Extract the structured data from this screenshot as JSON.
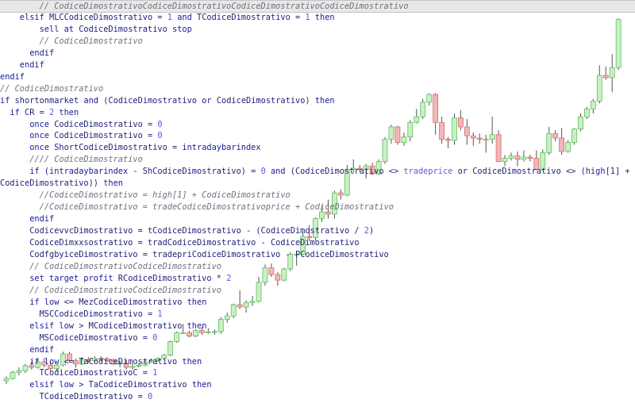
{
  "colors": {
    "bull_fill": "#c9f0c5",
    "bull_stroke": "#5fbf5f",
    "bear_fill": "#f2b6b6",
    "bear_stroke": "#d06f6f",
    "keyword": "#1a1a9a",
    "comment": "#707080",
    "number": "#5a5ae0",
    "text": "#22227a",
    "current_line_bg": "#e8e8e8"
  },
  "chart_data": {
    "type": "candlestick",
    "candles": [
      {
        "o": 0.0,
        "h": 2.0,
        "l": -1.5,
        "c": 1.0
      },
      {
        "o": 1.0,
        "h": 4.5,
        "l": 0.5,
        "c": 3.8
      },
      {
        "o": 3.8,
        "h": 6.0,
        "l": 2.5,
        "c": 4.5
      },
      {
        "o": 4.5,
        "h": 7.5,
        "l": 3.5,
        "c": 6.8
      },
      {
        "o": 6.8,
        "h": 8.5,
        "l": 5.0,
        "c": 6.0
      },
      {
        "o": 6.0,
        "h": 9.5,
        "l": 5.5,
        "c": 8.5
      },
      {
        "o": 8.5,
        "h": 10.0,
        "l": 6.0,
        "c": 7.0
      },
      {
        "o": 7.0,
        "h": 8.5,
        "l": 4.5,
        "c": 5.5
      },
      {
        "o": 5.5,
        "h": 7.5,
        "l": 4.5,
        "c": 7.0
      },
      {
        "o": 7.0,
        "h": 13.0,
        "l": 6.5,
        "c": 12.0
      },
      {
        "o": 12.0,
        "h": 13.0,
        "l": 8.5,
        "c": 9.0
      },
      {
        "o": 9.0,
        "h": 10.0,
        "l": 6.0,
        "c": 7.5
      },
      {
        "o": 7.5,
        "h": 10.5,
        "l": 7.0,
        "c": 9.5
      },
      {
        "o": 9.5,
        "h": 10.5,
        "l": 8.0,
        "c": 9.0
      },
      {
        "o": 9.0,
        "h": 11.0,
        "l": 8.0,
        "c": 10.0
      },
      {
        "o": 10.0,
        "h": 11.0,
        "l": 8.5,
        "c": 9.8
      },
      {
        "o": 9.8,
        "h": 10.5,
        "l": 8.5,
        "c": 9.0
      },
      {
        "o": 9.0,
        "h": 10.0,
        "l": 7.0,
        "c": 7.5
      },
      {
        "o": 7.5,
        "h": 9.0,
        "l": 6.0,
        "c": 8.0
      },
      {
        "o": 8.0,
        "h": 9.5,
        "l": 5.0,
        "c": 6.0
      },
      {
        "o": 6.0,
        "h": 7.5,
        "l": 5.0,
        "c": 6.5
      },
      {
        "o": 6.5,
        "h": 8.0,
        "l": 6.0,
        "c": 7.0
      },
      {
        "o": 7.0,
        "h": 9.5,
        "l": 6.5,
        "c": 8.5
      },
      {
        "o": 8.5,
        "h": 10.0,
        "l": 8.0,
        "c": 9.0
      },
      {
        "o": 9.0,
        "h": 10.5,
        "l": 8.5,
        "c": 10.0
      },
      {
        "o": 10.0,
        "h": 12.0,
        "l": 9.5,
        "c": 11.5
      },
      {
        "o": 11.5,
        "h": 18.0,
        "l": 11.0,
        "c": 17.5
      },
      {
        "o": 17.5,
        "h": 22.0,
        "l": 17.0,
        "c": 21.5
      },
      {
        "o": 21.5,
        "h": 25.5,
        "l": 21.0,
        "c": 21.5
      },
      {
        "o": 21.5,
        "h": 22.5,
        "l": 19.5,
        "c": 20.0
      },
      {
        "o": 20.0,
        "h": 23.0,
        "l": 19.5,
        "c": 22.5
      },
      {
        "o": 22.5,
        "h": 24.0,
        "l": 20.5,
        "c": 21.5
      },
      {
        "o": 21.5,
        "h": 23.5,
        "l": 21.0,
        "c": 22.0
      },
      {
        "o": 22.0,
        "h": 23.0,
        "l": 20.5,
        "c": 22.0
      },
      {
        "o": 22.0,
        "h": 28.5,
        "l": 21.0,
        "c": 27.5
      },
      {
        "o": 27.5,
        "h": 30.5,
        "l": 26.0,
        "c": 29.0
      },
      {
        "o": 29.0,
        "h": 34.5,
        "l": 28.0,
        "c": 34.0
      },
      {
        "o": 34.0,
        "h": 40.5,
        "l": 32.0,
        "c": 33.0
      },
      {
        "o": 33.0,
        "h": 36.0,
        "l": 30.5,
        "c": 35.0
      },
      {
        "o": 35.0,
        "h": 38.0,
        "l": 33.5,
        "c": 35.5
      },
      {
        "o": 35.5,
        "h": 46.5,
        "l": 35.0,
        "c": 44.0
      },
      {
        "o": 44.0,
        "h": 52.0,
        "l": 42.5,
        "c": 50.5
      },
      {
        "o": 50.5,
        "h": 52.5,
        "l": 46.5,
        "c": 47.5
      },
      {
        "o": 47.5,
        "h": 48.5,
        "l": 42.5,
        "c": 45.0
      },
      {
        "o": 45.0,
        "h": 50.5,
        "l": 44.5,
        "c": 50.0
      },
      {
        "o": 50.0,
        "h": 57.5,
        "l": 49.0,
        "c": 56.5
      },
      {
        "o": 56.5,
        "h": 57.0,
        "l": 51.5,
        "c": 56.5
      },
      {
        "o": 56.5,
        "h": 66.5,
        "l": 56.0,
        "c": 64.5
      },
      {
        "o": 64.5,
        "h": 69.5,
        "l": 62.5,
        "c": 64.0
      },
      {
        "o": 64.0,
        "h": 73.0,
        "l": 62.5,
        "c": 72.5
      },
      {
        "o": 72.5,
        "h": 78.0,
        "l": 71.0,
        "c": 75.5
      },
      {
        "o": 75.5,
        "h": 81.0,
        "l": 72.5,
        "c": 74.5
      },
      {
        "o": 74.5,
        "h": 85.0,
        "l": 72.5,
        "c": 84.0
      },
      {
        "o": 84.0,
        "h": 85.5,
        "l": 81.0,
        "c": 83.0
      },
      {
        "o": 83.0,
        "h": 96.5,
        "l": 82.5,
        "c": 94.5
      },
      {
        "o": 94.5,
        "h": 99.0,
        "l": 93.0,
        "c": 95.0
      },
      {
        "o": 95.0,
        "h": 96.5,
        "l": 93.5,
        "c": 94.5
      },
      {
        "o": 94.5,
        "h": 97.0,
        "l": 90.5,
        "c": 96.0
      },
      {
        "o": 96.0,
        "h": 97.5,
        "l": 92.0,
        "c": 92.5
      },
      {
        "o": 92.5,
        "h": 99.0,
        "l": 92.0,
        "c": 98.0
      },
      {
        "o": 98.0,
        "h": 109.0,
        "l": 97.0,
        "c": 108.0
      },
      {
        "o": 108.0,
        "h": 114.5,
        "l": 106.0,
        "c": 113.5
      },
      {
        "o": 113.5,
        "h": 114.0,
        "l": 105.5,
        "c": 106.5
      },
      {
        "o": 106.5,
        "h": 111.0,
        "l": 105.0,
        "c": 109.0
      },
      {
        "o": 109.0,
        "h": 116.5,
        "l": 107.0,
        "c": 115.5
      },
      {
        "o": 115.5,
        "h": 121.5,
        "l": 115.0,
        "c": 118.0
      },
      {
        "o": 118.0,
        "h": 126.0,
        "l": 117.0,
        "c": 124.5
      },
      {
        "o": 124.5,
        "h": 128.5,
        "l": 123.0,
        "c": 128.0
      },
      {
        "o": 128.0,
        "h": 128.5,
        "l": 110.0,
        "c": 115.5
      },
      {
        "o": 115.5,
        "h": 118.0,
        "l": 106.0,
        "c": 108.0
      },
      {
        "o": 108.0,
        "h": 109.0,
        "l": 104.0,
        "c": 107.5
      },
      {
        "o": 107.5,
        "h": 119.5,
        "l": 105.5,
        "c": 117.5
      },
      {
        "o": 117.5,
        "h": 121.0,
        "l": 112.0,
        "c": 113.5
      },
      {
        "o": 113.5,
        "h": 117.0,
        "l": 105.5,
        "c": 109.5
      },
      {
        "o": 109.5,
        "h": 111.0,
        "l": 105.0,
        "c": 108.5
      },
      {
        "o": 108.5,
        "h": 110.5,
        "l": 106.0,
        "c": 108.0
      },
      {
        "o": 108.0,
        "h": 110.0,
        "l": 102.0,
        "c": 108.0
      },
      {
        "o": 108.0,
        "h": 118.0,
        "l": 106.0,
        "c": 110.0
      },
      {
        "o": 110.0,
        "h": 112.0,
        "l": 99.5,
        "c": 98.0
      },
      {
        "o": 98.0,
        "h": 101.0,
        "l": 96.0,
        "c": 99.5
      },
      {
        "o": 99.5,
        "h": 102.0,
        "l": 98.5,
        "c": 100.5
      },
      {
        "o": 100.5,
        "h": 102.5,
        "l": 96.0,
        "c": 99.0
      },
      {
        "o": 99.0,
        "h": 103.0,
        "l": 98.0,
        "c": 100.0
      },
      {
        "o": 100.0,
        "h": 101.0,
        "l": 98.0,
        "c": 99.5
      },
      {
        "o": 99.5,
        "h": 103.0,
        "l": 94.0,
        "c": 94.5
      },
      {
        "o": 94.5,
        "h": 103.5,
        "l": 94.0,
        "c": 102.0
      },
      {
        "o": 102.0,
        "h": 113.5,
        "l": 101.0,
        "c": 110.5
      },
      {
        "o": 110.5,
        "h": 112.0,
        "l": 107.0,
        "c": 108.5
      },
      {
        "o": 108.5,
        "h": 113.0,
        "l": 101.0,
        "c": 102.5
      },
      {
        "o": 102.5,
        "h": 107.5,
        "l": 102.0,
        "c": 106.5
      },
      {
        "o": 106.5,
        "h": 113.0,
        "l": 105.5,
        "c": 112.5
      },
      {
        "o": 112.5,
        "h": 119.5,
        "l": 111.5,
        "c": 118.0
      },
      {
        "o": 118.0,
        "h": 122.5,
        "l": 117.0,
        "c": 121.5
      },
      {
        "o": 121.5,
        "h": 126.0,
        "l": 119.5,
        "c": 125.0
      },
      {
        "o": 125.0,
        "h": 141.0,
        "l": 124.0,
        "c": 136.5
      },
      {
        "o": 136.5,
        "h": 140.5,
        "l": 134.5,
        "c": 135.5
      },
      {
        "o": 135.5,
        "h": 146.0,
        "l": 129.0,
        "c": 140.0
      },
      {
        "o": 140.0,
        "h": 162.0,
        "l": 139.0,
        "c": 161.5
      }
    ]
  },
  "code": {
    "lines": [
      [
        {
          "t": "        // CodiceDimostrativoCodiceDimostrativoCodiceDimostrativoCodiceDimostrativo",
          "k": "cm"
        }
      ],
      [
        {
          "t": "    elsif ",
          "k": "kw"
        },
        {
          "t": "MLCCodiceDimostrativo = ",
          "k": "tx"
        },
        {
          "t": "1",
          "k": "nm"
        },
        {
          "t": " and ",
          "k": "kw"
        },
        {
          "t": "TCodiceDimostrativo = ",
          "k": "tx"
        },
        {
          "t": "1",
          "k": "nm"
        },
        {
          "t": " then",
          "k": "kw"
        }
      ],
      [
        {
          "t": "        sell at ",
          "k": "kw"
        },
        {
          "t": "CodiceDimostrativo ",
          "k": "tx"
        },
        {
          "t": "stop",
          "k": "kw"
        }
      ],
      [
        {
          "t": "        // CodiceDimostrativo",
          "k": "cm"
        }
      ],
      [
        {
          "t": "      endif",
          "k": "kw"
        }
      ],
      [
        {
          "t": "    endif",
          "k": "kw"
        }
      ],
      [
        {
          "t": "endif",
          "k": "kw"
        }
      ],
      [
        {
          "t": "// CodiceDimostrativo",
          "k": "cm"
        }
      ],
      [
        {
          "t": "if ",
          "k": "kw"
        },
        {
          "t": "shortonmarket ",
          "k": "tx"
        },
        {
          "t": "and ",
          "k": "kw"
        },
        {
          "t": "(CodiceDimostrativo ",
          "k": "tx"
        },
        {
          "t": "or ",
          "k": "kw"
        },
        {
          "t": "CodiceDimostrativo) ",
          "k": "tx"
        },
        {
          "t": "then",
          "k": "kw"
        }
      ],
      [
        {
          "t": "  if ",
          "k": "kw"
        },
        {
          "t": "CR = ",
          "k": "tx"
        },
        {
          "t": "2",
          "k": "nm"
        },
        {
          "t": " then",
          "k": "kw"
        }
      ],
      [
        {
          "t": "      once ",
          "k": "kw"
        },
        {
          "t": "CodiceDimostrativo = ",
          "k": "tx"
        },
        {
          "t": "0",
          "k": "nm"
        }
      ],
      [
        {
          "t": "      once ",
          "k": "kw"
        },
        {
          "t": "CodiceDimostrativo = ",
          "k": "tx"
        },
        {
          "t": "0",
          "k": "nm"
        }
      ],
      [
        {
          "t": "      once ",
          "k": "kw"
        },
        {
          "t": "ShortCodiceDimostrativo = ",
          "k": "tx"
        },
        {
          "t": "intradaybarindex",
          "k": "kw"
        }
      ],
      [
        {
          "t": "      //// CodiceDimostrativo",
          "k": "cm"
        }
      ],
      [
        {
          "t": "      if ",
          "k": "kw"
        },
        {
          "t": "(intradaybarindex",
          "k": "kw"
        },
        {
          "t": " - ShCodiceDimostrativo) = ",
          "k": "tx"
        },
        {
          "t": "0",
          "k": "nm"
        },
        {
          "t": " and ",
          "k": "kw"
        },
        {
          "t": "(CodiceDimostrativo <> ",
          "k": "tx"
        },
        {
          "t": "tradeprice",
          "k": "nm"
        },
        {
          "t": " or ",
          "k": "kw"
        },
        {
          "t": "CodiceDimostrativo <> (",
          "k": "tx"
        },
        {
          "t": "high",
          "k": "kw"
        },
        {
          "t": "[1] + ",
          "k": "tx"
        }
      ],
      [
        {
          "t": "CodiceDimostrativo)) ",
          "k": "tx"
        },
        {
          "t": "then",
          "k": "kw"
        }
      ],
      [
        {
          "t": "        //CodiceDimostrativo = high[1] + CodiceDimostrativo",
          "k": "cm"
        }
      ],
      [
        {
          "t": "        //CodiceDimostrativo = tradeCodiceDimostrativoprice + CodiceDimostrativo",
          "k": "cm"
        }
      ],
      [
        {
          "t": "      endif",
          "k": "kw"
        }
      ],
      [
        {
          "t": "      CodicevvcDimostrativo = tCodiceDimostrativo - (CodiceDimostrativo / ",
          "k": "tx"
        },
        {
          "t": "2",
          "k": "nm"
        },
        {
          "t": ")",
          "k": "tx"
        }
      ],
      [
        {
          "t": "      CodiceDimxxsostrativo = tradCodiceDimostrativo - CodiceDimostrativo",
          "k": "tx"
        }
      ],
      [
        {
          "t": "      CodfgbyiceDimostrativo = tradepriCodiceDimostrativo - PCodiceDimostrativo",
          "k": "tx"
        }
      ],
      [
        {
          "t": "      // CodiceDimostrativoCodiceDimostrativo",
          "k": "cm"
        }
      ],
      [
        {
          "t": "      set target profit ",
          "k": "kw"
        },
        {
          "t": "RCodiceDimostrativo * ",
          "k": "tx"
        },
        {
          "t": "2",
          "k": "nm"
        }
      ],
      [
        {
          "t": "      // CodiceDimostrativoCodiceDimostrativo",
          "k": "cm"
        }
      ],
      [
        {
          "t": "      if ",
          "k": "kw"
        },
        {
          "t": "low",
          "k": "kw"
        },
        {
          "t": " <= MezCodiceDimostrativo ",
          "k": "tx"
        },
        {
          "t": "then",
          "k": "kw"
        }
      ],
      [
        {
          "t": "        MSCCodiceDimostrativo = ",
          "k": "tx"
        },
        {
          "t": "1",
          "k": "nm"
        }
      ],
      [
        {
          "t": "      elsif ",
          "k": "kw"
        },
        {
          "t": "low",
          "k": "kw"
        },
        {
          "t": " > MCodiceDimostrativo ",
          "k": "tx"
        },
        {
          "t": "then",
          "k": "kw"
        }
      ],
      [
        {
          "t": "        MSCodiceDimostrativo = ",
          "k": "tx"
        },
        {
          "t": "0",
          "k": "nm"
        }
      ],
      [
        {
          "t": "      endif",
          "k": "kw"
        }
      ],
      [
        {
          "t": "      if ",
          "k": "kw"
        },
        {
          "t": "low",
          "k": "kw"
        },
        {
          "t": " <= TaCodiceDimostrativo ",
          "k": "tx"
        },
        {
          "t": "then",
          "k": "kw"
        }
      ],
      [
        {
          "t": "        TCodiceDimostrativoC = ",
          "k": "tx"
        },
        {
          "t": "1",
          "k": "nm"
        }
      ],
      [
        {
          "t": "      elsif ",
          "k": "kw"
        },
        {
          "t": "low",
          "k": "kw"
        },
        {
          "t": " > TaCodiceDimostrativo ",
          "k": "tx"
        },
        {
          "t": "then",
          "k": "kw"
        }
      ],
      [
        {
          "t": "        TCodiceDimostrativo = ",
          "k": "tx"
        },
        {
          "t": "0",
          "k": "nm"
        }
      ]
    ]
  }
}
